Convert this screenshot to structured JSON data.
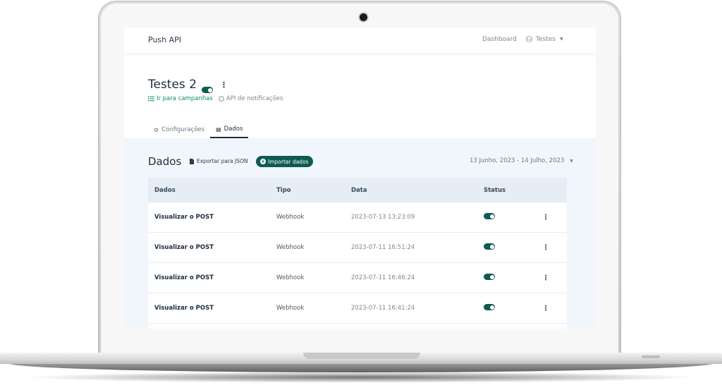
{
  "app": {
    "brand": "Push API"
  },
  "nav": {
    "dashboard": "Dashboard",
    "user": "Testes"
  },
  "page": {
    "title": "Testes 2",
    "active": true,
    "link_campaigns": "Ir para campanhas",
    "link_api": "API de notificações"
  },
  "tabs": [
    {
      "label": "Configurações",
      "icon": "gears-icon",
      "active": false
    },
    {
      "label": "Dados",
      "icon": "database-icon",
      "active": true
    }
  ],
  "data_section": {
    "title": "Dados",
    "export_label": "Exportar para JSON",
    "import_label": "Importar dados",
    "date_range": "13 Junho, 2023 - 14 Julho, 2023"
  },
  "table": {
    "headers": [
      "Dados",
      "Tipo",
      "Data",
      "Status"
    ],
    "rows": [
      {
        "dados": "Visualizar o POST",
        "tipo": "Webhook",
        "data": "2023-07-13 13:23:09",
        "status": true
      },
      {
        "dados": "Visualizar o POST",
        "tipo": "Webhook",
        "data": "2023-07-11 16:51:24",
        "status": true
      },
      {
        "dados": "Visualizar o POST",
        "tipo": "Webhook",
        "data": "2023-07-11 16:46:24",
        "status": true
      },
      {
        "dados": "Visualizar o POST",
        "tipo": "Webhook",
        "data": "2023-07-11 16:41:24",
        "status": true
      }
    ]
  },
  "colors": {
    "accent": "#0f5a52",
    "link": "#0f8a6d",
    "panel": "#f1f6fc"
  }
}
